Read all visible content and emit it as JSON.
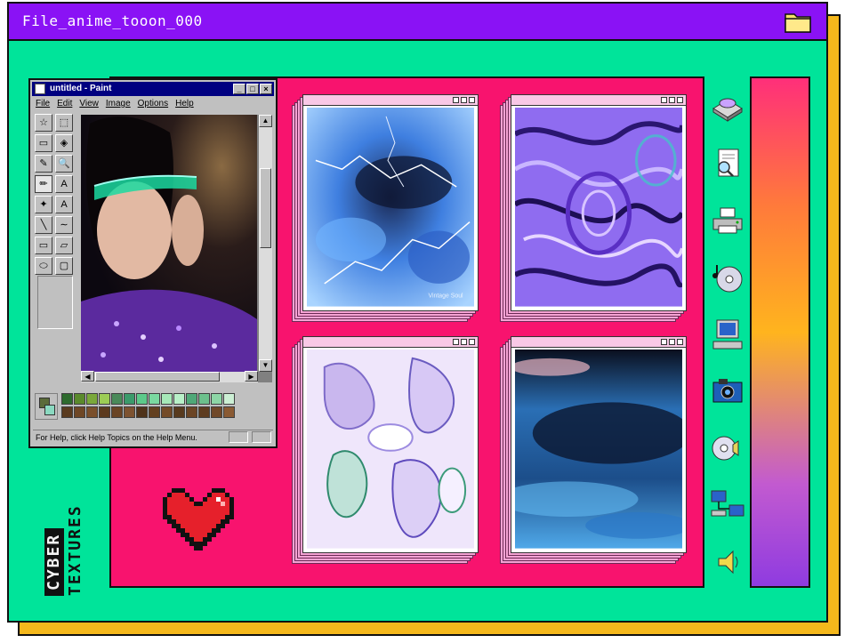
{
  "window": {
    "title": "File_anime_tooon_000",
    "folder_icon": "folder-icon"
  },
  "paint": {
    "title": "untitled - Paint",
    "window_buttons": [
      "_",
      "□",
      "×"
    ],
    "menu": [
      "File",
      "Edit",
      "View",
      "Image",
      "Options",
      "Help"
    ],
    "tools": [
      "free-select",
      "rect-select",
      "eraser",
      "fill",
      "eyedropper",
      "magnifier",
      "pencil",
      "brush",
      "airbrush",
      "text",
      "line",
      "curve",
      "rectangle",
      "polygon",
      "ellipse",
      "rounded-rect"
    ],
    "tool_glyphs": [
      "☆",
      "⬚",
      "▭",
      "◈",
      "✎",
      "🔍",
      "✏",
      "A",
      "✦",
      "A",
      "╲",
      "∼",
      "▭",
      "▱",
      "⬭",
      "▢"
    ],
    "status_text": "For Help, click Help Topics on the Help Menu.",
    "palette_colors": [
      "#2e6b2e",
      "#5a8a2c",
      "#7aa83a",
      "#9ccc55",
      "#4a8a5a",
      "#3b9b6b",
      "#5cc98a",
      "#7ad9a0",
      "#a6e8b8",
      "#b8f0c8",
      "#4fa878",
      "#6cc08c",
      "#8dd6a6",
      "#ccefd4",
      "#5a3b1f",
      "#6e4726",
      "#7a4f2b",
      "#5c3a1e",
      "#6a4424",
      "#7d5230",
      "#4f331a",
      "#63401f",
      "#744b28",
      "#583a1e",
      "#6b4525",
      "#5e3c1f",
      "#704828",
      "#8a5a33"
    ]
  },
  "gallery": {
    "textures": [
      {
        "name": "lightning-water",
        "caption": "Vintage Soul"
      },
      {
        "name": "holographic-swirl",
        "caption": ""
      },
      {
        "name": "liquid-chrome",
        "caption": ""
      },
      {
        "name": "blurred-blue-photo",
        "caption": ""
      }
    ]
  },
  "sidebar_icons": [
    "disk-drive-icon",
    "document-search-icon",
    "printer-icon",
    "music-cd-icon",
    "computer-icon",
    "camera-icon",
    "cd-speaker-icon",
    "network-icon",
    "speaker-icon"
  ],
  "brand": {
    "line1": "CYBER",
    "line2": "TEXTURES"
  },
  "colors": {
    "title_bar": "#8a12f5",
    "background": "#00e49a",
    "panel": "#f8136e",
    "shadow": "#f5b81c"
  }
}
